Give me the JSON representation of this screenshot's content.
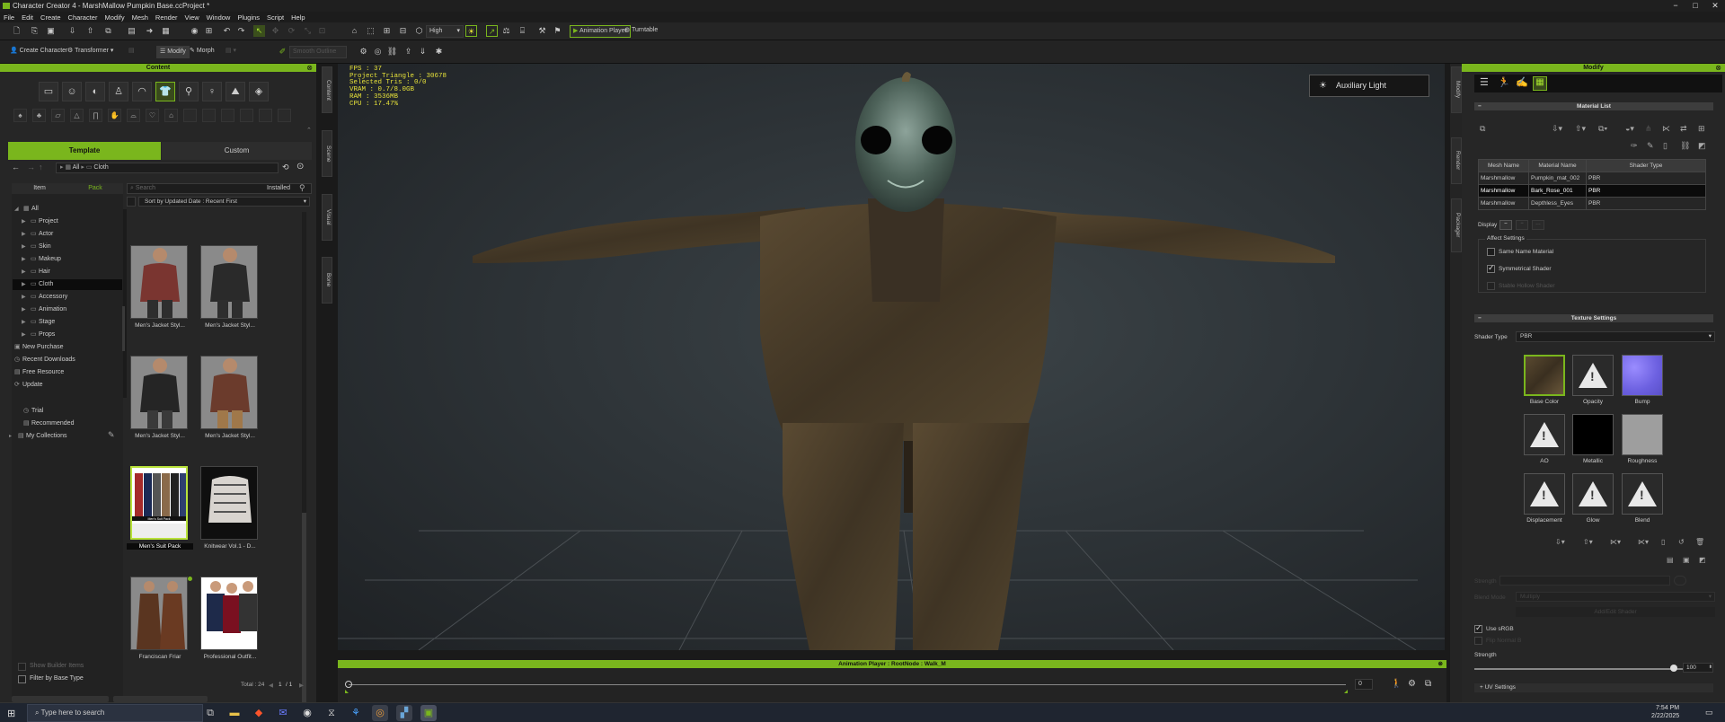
{
  "window": {
    "title": "Character Creator 4 - MarshMallow Pumpkin Base.ccProject *",
    "min": "−",
    "max": "□",
    "close": "✕"
  },
  "menu": [
    "File",
    "Edit",
    "Create",
    "Character",
    "Modify",
    "Mesh",
    "Render",
    "View",
    "Window",
    "Plugins",
    "Script",
    "Help"
  ],
  "toolbar": {
    "quality": "High",
    "animation_player": "Animation Player",
    "turntable": "Turntable",
    "create_character": "Create Character",
    "transformer": "Transformer",
    "modify": "Modify",
    "morph": "Morph",
    "search_placeholder": "Smooth Outline"
  },
  "content_panel": {
    "title": "Content",
    "tabs": {
      "template": "Template",
      "custom": "Custom"
    },
    "path": {
      "all": "All",
      "cloth": "Cloth"
    },
    "subtabs": {
      "item": "Item",
      "pack": "Pack"
    },
    "search_placeholder": "Search",
    "installed": "Installed",
    "sort": "Sort by Updated Date : Recent First",
    "tree": [
      {
        "label": "All",
        "arrow": true
      },
      {
        "label": "Project",
        "arrow": true
      },
      {
        "label": "Actor",
        "arrow": true
      },
      {
        "label": "Skin",
        "arrow": true
      },
      {
        "label": "Makeup",
        "arrow": true
      },
      {
        "label": "Hair",
        "arrow": true
      },
      {
        "label": "Cloth",
        "arrow": true,
        "selected": true
      },
      {
        "label": "Accessory",
        "arrow": true
      },
      {
        "label": "Animation",
        "arrow": true
      },
      {
        "label": "Stage",
        "arrow": true
      },
      {
        "label": "Props",
        "arrow": true
      },
      {
        "label": "New Purchase",
        "arrow": false
      },
      {
        "label": "Recent Downloads",
        "arrow": false
      },
      {
        "label": "Free Resource",
        "arrow": false
      },
      {
        "label": "Update",
        "arrow": false
      }
    ],
    "tree2": [
      "Trial",
      "Recommended",
      "My Collections"
    ],
    "thumbs": [
      "Men's Jacket Styl...",
      "Men's Jacket Styl...",
      "Men's Jacket Styl...",
      "Men's Jacket Styl...",
      "Men's Suit Pack",
      "Knitwear Vol.1 - D...",
      "Franciscan Friar",
      "Professional Outfit..."
    ],
    "suit_pack_banner": "Men's Suit Pack",
    "show_builder": "Show Builder Items",
    "filter_base": "Filter by Base Type",
    "total": "Total : 24",
    "page": "1",
    "page_total": "/ 1"
  },
  "side_tabs": [
    "Content",
    "Scene",
    "Visual",
    "Bone"
  ],
  "right_side_tabs": [
    "Modify",
    "Render",
    "Packager"
  ],
  "viewport": {
    "stats": [
      "FPS : 37",
      "Project Triangle : 30678",
      "Selected Tris : 0/0",
      "VRAM : 0.7/8.0GB",
      "RAM : 3536MB",
      "CPU : 17.47%"
    ],
    "aux_light": "Auxiliary Light"
  },
  "anim_player": {
    "title": "Animation Player : RootNode : Walk_M",
    "frame": "0"
  },
  "modify_panel": {
    "title": "Modify",
    "material_list": "Material List",
    "table_headers": [
      "Mesh Name",
      "Material Name",
      "Shader Type"
    ],
    "rows": [
      [
        "Marshmallow",
        "Pumpkin_mat_002",
        "PBR"
      ],
      [
        "Marshmallow",
        "Bark_Rose_001",
        "PBR"
      ],
      [
        "Marshmallow",
        "Depthless_Eyes",
        "PBR"
      ]
    ],
    "display": "Display",
    "affect_settings": "Affect Settings",
    "same_name": "Same Name Material",
    "symmetrical": "Symmetrical Shader",
    "stable_hollow": "Stable Hollow Shader",
    "texture_settings": "Texture Settings",
    "shader_type_label": "Shader Type",
    "shader_type": "PBR",
    "textures": [
      "Base Color",
      "Opacity",
      "Bump",
      "AO",
      "Metallic",
      "Roughness",
      "Displacement",
      "Glow",
      "Blend"
    ],
    "strength_faded": "Strength",
    "blend_mode": "Blend Mode",
    "blend_value": "Multiply",
    "add_shader": "Add/Edit Shader",
    "use_srgb": "Use sRGB",
    "flip_normal": "Flip Normal B",
    "strength": "Strength",
    "strength_value": "100",
    "uv_settings": "UV Settings"
  },
  "taskbar": {
    "search": "Type here to search",
    "time": "7:54 PM",
    "date": "2/22/2025"
  },
  "colors": {
    "accent": "#7ab61d",
    "stats": "#e7e23a"
  }
}
